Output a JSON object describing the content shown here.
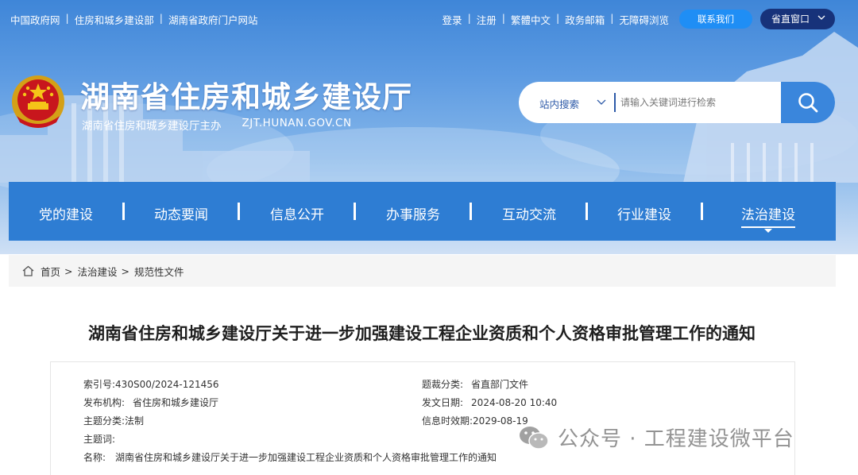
{
  "topbar": {
    "gov_links": [
      "中国政府网",
      "住房和城乡建设部",
      "湖南省政府门户网站"
    ],
    "user_links": [
      "登录",
      "注册",
      "繁體中文",
      "政务邮箱",
      "无障碍浏览"
    ],
    "contact_label": "联系我们",
    "province_label": "省直窗口"
  },
  "brand": {
    "title": "湖南省住房和城乡建设厅",
    "sponsor": "湖南省住房和城乡建设厅主办",
    "domain": "ZJT.HUNAN.GOV.CN"
  },
  "search": {
    "scope": "站内搜索",
    "placeholder": "请输入关键词进行检索"
  },
  "nav": {
    "items": [
      "党的建设",
      "动态要闻",
      "信息公开",
      "办事服务",
      "互动交流",
      "行业建设",
      "法治建设"
    ],
    "active": "法治建设"
  },
  "breadcrumb": [
    "首页",
    "法治建设",
    "规范性文件"
  ],
  "article": {
    "title": "湖南省住房和城乡建设厅关于进一步加强建设工程企业资质和个人资格审批管理工作的通知",
    "meta": {
      "index_label": "索引号:",
      "index_value": "430S00/2024-121456",
      "category_label": "题裁分类:",
      "category_value": "省直部门文件",
      "issuer_label": "发布机构:",
      "issuer_value": "省住房和城乡建设厅",
      "date_label": "发文日期:",
      "date_value": "2024-08-20 10:40",
      "topic_label": "主题分类:",
      "topic_value": "法制",
      "expiry_label": "信息时效期:",
      "expiry_value": "2029-08-19",
      "keywords_label": "主题词:",
      "keywords_value": "",
      "name_label": "名称:",
      "name_value": "湖南省住房和城乡建设厅关于进一步加强建设工程企业资质和个人资格审批管理工作的通知"
    }
  },
  "watermark": {
    "text": "公众号 · 工程建设微平台"
  },
  "colors": {
    "nav_bg": "#2e7dd3",
    "search_btn": "#3a86dc",
    "contact_btn": "#1f8ef5",
    "province_btn": "#17327a"
  }
}
